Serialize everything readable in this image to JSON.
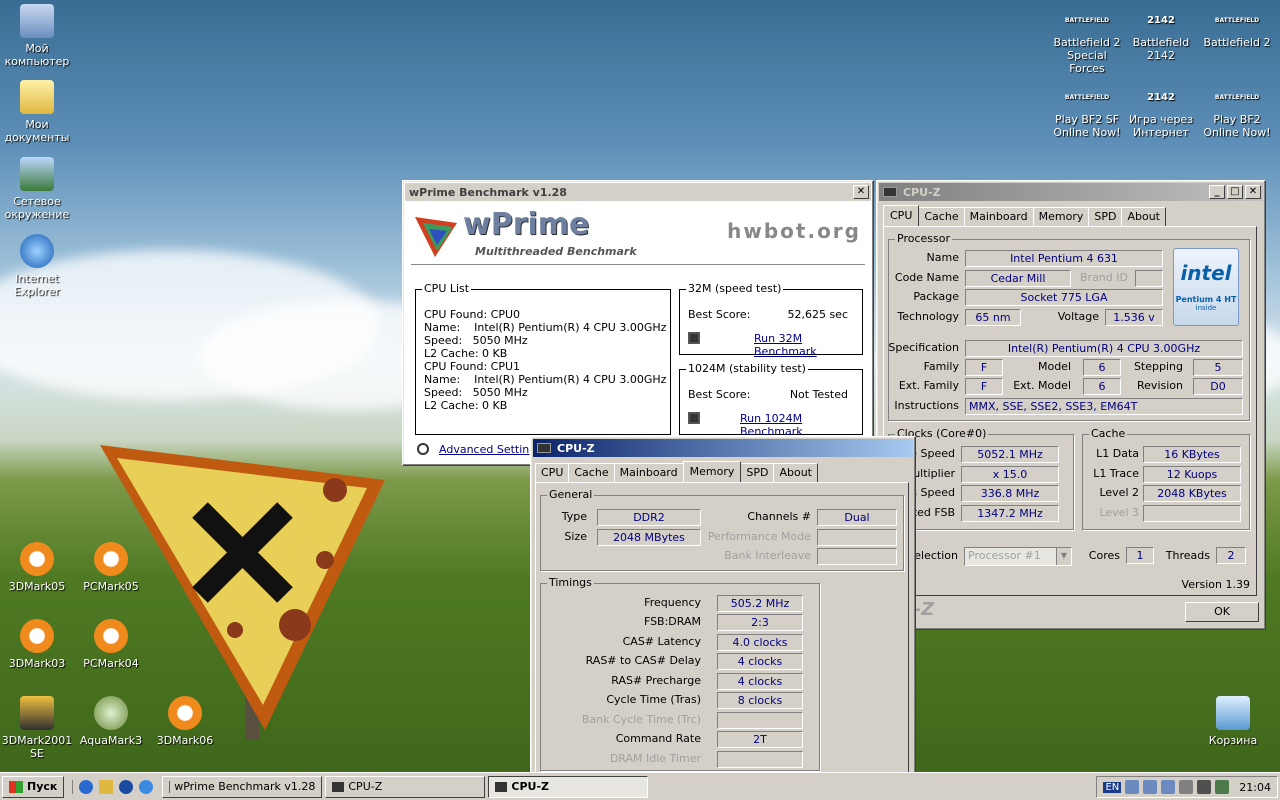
{
  "desktop": {
    "icons_left": [
      {
        "label1": "Мой",
        "label2": "компьютер"
      },
      {
        "label1": "Мои",
        "label2": "документы"
      },
      {
        "label1": "Сетевое",
        "label2": "окружение"
      },
      {
        "label1": "Internet",
        "label2": "Explorer"
      },
      {
        "label1": "3DMark05",
        "label2": ""
      },
      {
        "label1": "PCMark05",
        "label2": ""
      },
      {
        "label1": "3DMark03",
        "label2": ""
      },
      {
        "label1": "PCMark04",
        "label2": ""
      },
      {
        "label1": "3DMark2001",
        "label2": "SE"
      },
      {
        "label1": "AquaMark3",
        "label2": ""
      },
      {
        "label1": "3DMark06",
        "label2": ""
      }
    ],
    "icons_right": [
      {
        "label1": "Battlefield 2",
        "label2": "Special Forces",
        "badge": "BATTLEFIELD"
      },
      {
        "label1": "Battlefield",
        "label2": "2142",
        "badge": "2142"
      },
      {
        "label1": "Battlefield 2",
        "label2": "",
        "badge": "BATTLEFIELD"
      },
      {
        "label1": "Play BF2 SF",
        "label2": "Online Now!",
        "badge": "BATTLEFIELD"
      },
      {
        "label1": "Игра через",
        "label2": "Интернет",
        "badge": "2142"
      },
      {
        "label1": "Play BF2",
        "label2": "Online Now!",
        "badge": "BATTLEFIELD"
      }
    ],
    "recycle_label": "Корзина"
  },
  "wprime": {
    "title": "wPrime Benchmark v1.28",
    "logo": "wPrime",
    "logo_sub": "Multithreaded Benchmark",
    "hwbot": "hwbot.org",
    "cpu_list_label": "CPU List",
    "cpu_lines": [
      "CPU Found: CPU0",
      "Name:    Intel(R) Pentium(R) 4 CPU 3.00GHz",
      "Speed:   5050 MHz",
      "L2 Cache: 0 KB",
      "CPU Found: CPU1",
      "Name:    Intel(R) Pentium(R) 4 CPU 3.00GHz",
      "Speed:   5050 MHz",
      "L2 Cache: 0 KB"
    ],
    "t32_label": "32M (speed test)",
    "t32_best_label": "Best Score:",
    "t32_best": "52,625 sec",
    "t32_run": "Run 32M Benchmark",
    "t1024_label": "1024M (stability test)",
    "t1024_best_label": "Best Score:",
    "t1024_best": "Not Tested",
    "t1024_run": "Run 1024M Benchmark",
    "advanced": "Advanced Settings"
  },
  "cpuz_main": {
    "title": "CPU-Z",
    "tabs": [
      "CPU",
      "Cache",
      "Mainboard",
      "Memory",
      "SPD",
      "About"
    ],
    "processor_label": "Processor",
    "name_label": "Name",
    "name": "Intel Pentium 4 631",
    "codename_label": "Code Name",
    "codename": "Cedar Mill",
    "brandid_label": "Brand ID",
    "package_label": "Package",
    "package": "Socket 775 LGA",
    "technology_label": "Technology",
    "technology": "65 nm",
    "voltage_label": "Voltage",
    "voltage": "1.536 v",
    "spec_label": "Specification",
    "spec": "Intel(R) Pentium(R) 4 CPU 3.00GHz",
    "family_label": "Family",
    "family": "F",
    "model_label": "Model",
    "model": "6",
    "stepping_label": "Stepping",
    "stepping": "5",
    "extfamily_label": "Ext. Family",
    "extfamily": "F",
    "extmodel_label": "Ext. Model",
    "extmodel": "6",
    "revision_label": "Revision",
    "revision": "D0",
    "instr_label": "Instructions",
    "instr": "MMX, SSE, SSE2, SSE3, EM64T",
    "intel_logo": "intel",
    "intel_sub": "Pentium 4 HT",
    "intel_inside": "inside",
    "clocks_label": "Clocks (Core#0)",
    "core_speed_label": "e Speed",
    "core_speed": "5052.1 MHz",
    "mult_label": "Multiplier",
    "mult": "x 15.0",
    "bus_label": "s Speed",
    "bus": "336.8 MHz",
    "fsb_label": "ated FSB",
    "fsb": "1347.2 MHz",
    "cache_label": "Cache",
    "l1d_label": "L1 Data",
    "l1d": "16 KBytes",
    "l1t_label": "L1 Trace",
    "l1t": "12 Kuops",
    "l2_label": "Level 2",
    "l2": "2048 KBytes",
    "l3_label": "Level 3",
    "selection_label": "election",
    "selection": "Processor #1",
    "cores_label": "Cores",
    "cores": "1",
    "threads_label": "Threads",
    "threads": "2",
    "version": "Version 1.39",
    "brand_footer": "U-Z",
    "ok": "OK"
  },
  "cpuz_mem": {
    "title": "CPU-Z",
    "tabs": [
      "CPU",
      "Cache",
      "Mainboard",
      "Memory",
      "SPD",
      "About"
    ],
    "general_label": "General",
    "type_label": "Type",
    "type": "DDR2",
    "channels_label": "Channels #",
    "channels": "Dual",
    "size_label": "Size",
    "size": "2048 MBytes",
    "perfmode_label": "Performance Mode",
    "bankint_label": "Bank Interleave",
    "timings_label": "Timings",
    "timings": [
      {
        "label": "Frequency",
        "value": "505.2 MHz",
        "disabled": false
      },
      {
        "label": "FSB:DRAM",
        "value": "2:3",
        "disabled": false
      },
      {
        "label": "CAS# Latency",
        "value": "4.0 clocks",
        "disabled": false
      },
      {
        "label": "RAS# to CAS# Delay",
        "value": "4 clocks",
        "disabled": false
      },
      {
        "label": "RAS# Precharge",
        "value": "4 clocks",
        "disabled": false
      },
      {
        "label": "Cycle Time (Tras)",
        "value": "8 clocks",
        "disabled": false
      },
      {
        "label": "Bank Cycle Time (Trc)",
        "value": "",
        "disabled": true
      },
      {
        "label": "Command Rate",
        "value": "2T",
        "disabled": false
      },
      {
        "label": "DRAM Idle Timer",
        "value": "",
        "disabled": true
      }
    ]
  },
  "taskbar": {
    "start": "Пуск",
    "tasks": [
      "wPrime Benchmark v1.28",
      "CPU-Z",
      "CPU-Z"
    ],
    "lang": "EN",
    "clock": "21:04"
  }
}
